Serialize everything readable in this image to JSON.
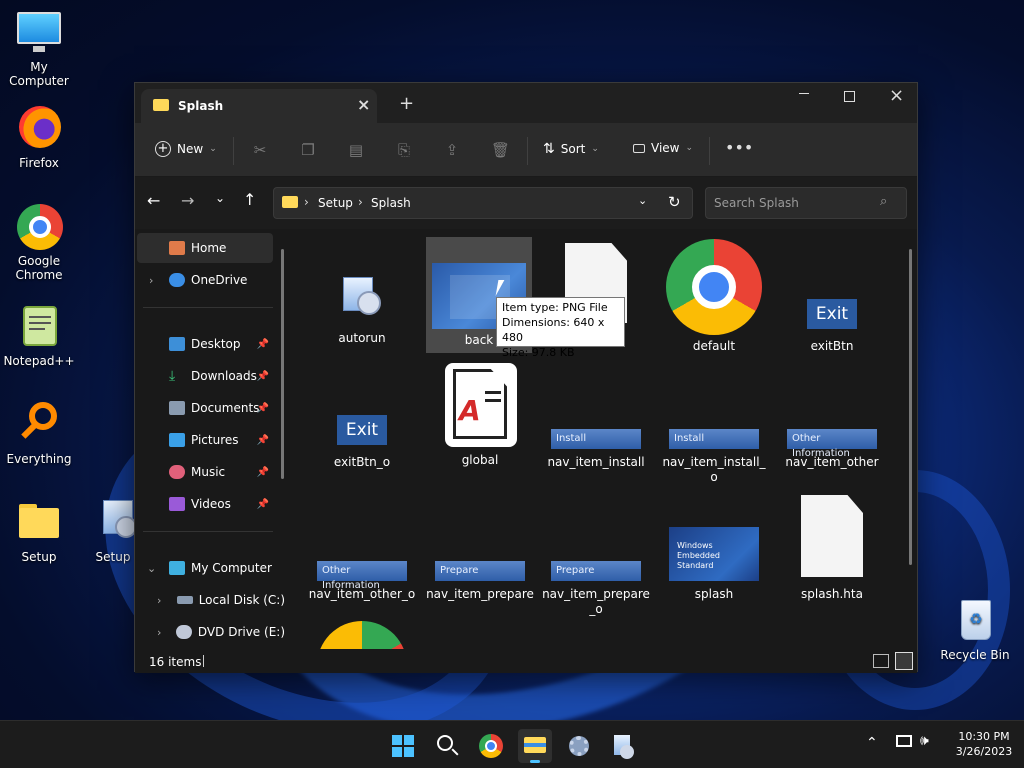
{
  "desktop": {
    "icons": [
      {
        "label": "My Computer",
        "icon": "monitor-icon"
      },
      {
        "label": "Firefox",
        "icon": "firefox-icon"
      },
      {
        "label": "Google Chrome",
        "icon": "chrome-icon"
      },
      {
        "label": "Notepad++",
        "icon": "notepad-icon"
      },
      {
        "label": "Everything",
        "icon": "search-magnifier-icon"
      },
      {
        "label": "Setup",
        "icon": "folder-icon"
      },
      {
        "label": "Setup",
        "icon": "setup-installer-icon"
      },
      {
        "label": "Recycle Bin",
        "icon": "recycle-bin-icon"
      }
    ]
  },
  "explorer": {
    "tab_title": "Splash",
    "toolbar": {
      "new_label": "New",
      "sort_label": "Sort",
      "view_label": "View"
    },
    "breadcrumb": [
      "Setup",
      "Splash"
    ],
    "search_placeholder": "Search Splash",
    "sidebar": {
      "items": [
        {
          "label": "Home"
        },
        {
          "label": "OneDrive"
        },
        {
          "label": "Desktop"
        },
        {
          "label": "Downloads"
        },
        {
          "label": "Documents"
        },
        {
          "label": "Pictures"
        },
        {
          "label": "Music"
        },
        {
          "label": "Videos"
        },
        {
          "label": "My Computer"
        },
        {
          "label": "Local Disk (C:)"
        },
        {
          "label": "DVD Drive (E:)"
        }
      ]
    },
    "files": [
      {
        "name": "autorun",
        "icon": "installer-icon"
      },
      {
        "name": "back",
        "icon": "image-thumbnail"
      },
      {
        "name": "",
        "icon": "blank-file-icon"
      },
      {
        "name": "default",
        "icon": "chrome-icon"
      },
      {
        "name": "exitBtn",
        "icon": "exit-button-image",
        "thumb_text": "Exit"
      },
      {
        "name": "exitBtn_o",
        "icon": "exit-button-image",
        "thumb_text": "Exit"
      },
      {
        "name": "global",
        "icon": "font-file-icon"
      },
      {
        "name": "nav_item_install",
        "icon": "nav-image",
        "thumb_text": "Install"
      },
      {
        "name": "nav_item_install_o",
        "icon": "nav-image",
        "thumb_text": "Install"
      },
      {
        "name": "nav_item_other",
        "icon": "nav-image",
        "thumb_text": "Other Information"
      },
      {
        "name": "nav_item_other_o",
        "icon": "nav-image",
        "thumb_text": "Other Information"
      },
      {
        "name": "nav_item_prepare",
        "icon": "nav-image",
        "thumb_text": "Prepare"
      },
      {
        "name": "nav_item_prepare_o",
        "icon": "nav-image",
        "thumb_text": "Prepare"
      },
      {
        "name": "splash",
        "icon": "splash-image",
        "thumb_text": "Windows Embedded Standard"
      },
      {
        "name": "splash.hta",
        "icon": "blank-file-icon"
      },
      {
        "name": "",
        "icon": "chrome-icon"
      }
    ],
    "tooltip": {
      "line1": "Item type: PNG File",
      "line2": "Dimensions: 640 x 480",
      "line3": "Size: 97.8 KB"
    },
    "status": {
      "items_count": "16 items"
    }
  },
  "taskbar": {
    "time": "10:30 PM",
    "date": "3/26/2023"
  },
  "colors": {
    "accent": "#4cc2ff",
    "window_bg": "#191919",
    "nav_blue": "#2f5ea8"
  }
}
